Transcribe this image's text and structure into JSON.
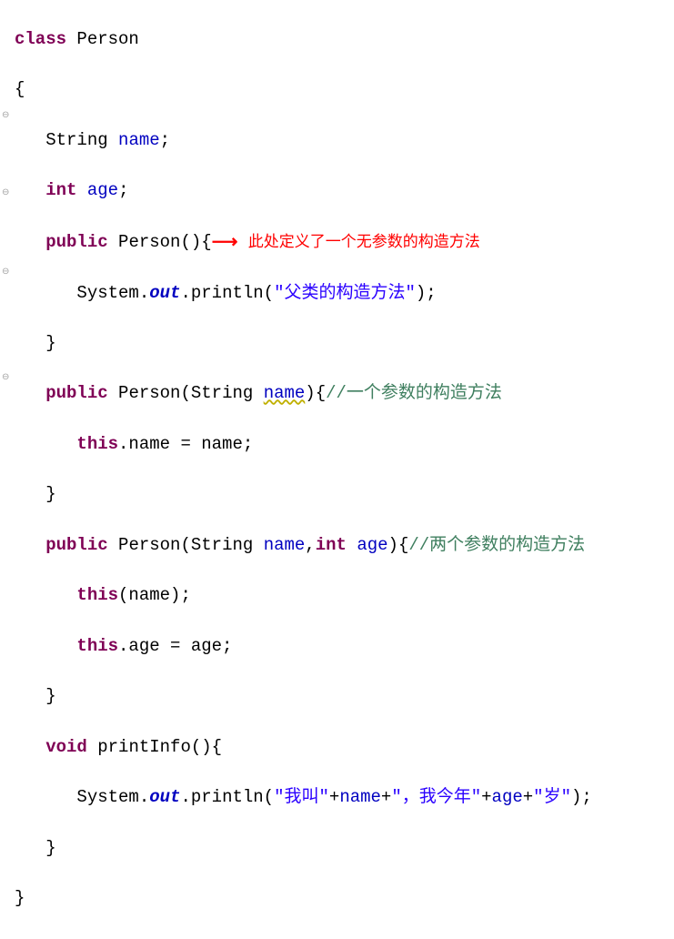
{
  "code": {
    "l1": {
      "kw": "class",
      "name": "Person"
    },
    "l2": {
      "brace": "{"
    },
    "l3": {
      "type": "String",
      "id": "name",
      "semi": ";"
    },
    "l4": {
      "type": "int",
      "id": "age",
      "semi": ";"
    },
    "l5": {
      "kw": "public",
      "name": "Person",
      "sig": "(){",
      "annot": "此处定义了一个无参数的构造方法"
    },
    "l6": {
      "sys": "System.",
      "out": "out",
      "rest": ".println(",
      "str": "\"父类的构造方法\"",
      "close": ");"
    },
    "l7": {
      "brace": "}"
    },
    "l8": {
      "kw": "public",
      "name": "Person",
      "sig1": "(String ",
      "param1": "name",
      "sig2": "){",
      "cmt": "//一个参数的构造方法"
    },
    "l9": {
      "this": "this",
      "rest": ".name = name;"
    },
    "l10": {
      "brace": "}"
    },
    "l11": {
      "kw": "public",
      "name": "Person",
      "sig1": "(String ",
      "param1": "name",
      "comma": ",",
      "int": "int",
      "sp": " ",
      "param2": "age",
      "sig2": "){",
      "cmt": "//两个参数的构造方法"
    },
    "l12": {
      "this": "this",
      "rest": "(name);"
    },
    "l13": {
      "this": "this",
      "rest": ".age = age;"
    },
    "l14": {
      "brace": "}"
    },
    "l15": {
      "kw": "void",
      "name": "printInfo",
      "sig": "(){"
    },
    "l16": {
      "sys": "System.",
      "out": "out",
      "rest": ".println(",
      "str1": "\"我叫\"",
      "plus1": "+",
      "id1": "name",
      "plus2": "+",
      "str2": "\"，我今年\"",
      "plus3": "+",
      "id2": "age",
      "plus4": "+",
      "str3": "\"岁\"",
      "close": ");"
    },
    "l17": {
      "brace": "}"
    },
    "l18": {
      "brace": "}"
    }
  },
  "folds": [
    118,
    206,
    294,
    440
  ],
  "colors": {
    "keyword": "#7f0055",
    "identifier": "#0000c0",
    "string": "#2a00ff",
    "comment": "#3f7f5f",
    "annotation": "#ff0000"
  }
}
